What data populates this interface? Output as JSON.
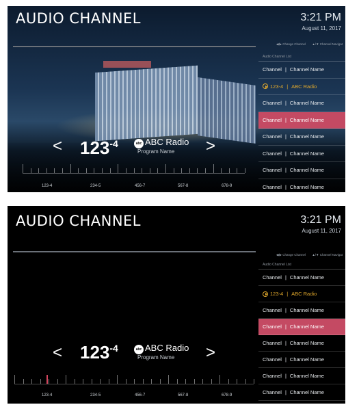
{
  "screens": [
    {
      "title": "AUDIO CHANNEL",
      "time": "3:21 PM",
      "date": "August 11, 2017",
      "hints": [
        "◀/▶ Change Channel",
        "▲/▼ Channel Navigat"
      ],
      "list_header": "Audio Channel List",
      "list": [
        {
          "left": "Channel",
          "sep": "|",
          "right": "Channel Name",
          "state": "normal"
        },
        {
          "left": "123-4",
          "sep": "|",
          "right": "ABC Radio",
          "state": "playing"
        },
        {
          "left": "Channel",
          "sep": "|",
          "right": "Channel Name",
          "state": "normal"
        },
        {
          "left": "Channel",
          "sep": "|",
          "right": "Channel Name",
          "state": "selected"
        },
        {
          "left": "Channel",
          "sep": "|",
          "right": "Channel Name",
          "state": "normal"
        },
        {
          "left": "Channel",
          "sep": "|",
          "right": "Channel Name",
          "state": "normal"
        },
        {
          "left": "Channel",
          "sep": "|",
          "right": "Channel Name",
          "state": "normal"
        },
        {
          "left": "Channel",
          "sep": "|",
          "right": "Channel Name",
          "state": "normal"
        }
      ],
      "prev_arrow": "<",
      "next_arrow": ">",
      "channel_major": "123",
      "channel_minor": "-4",
      "logo": "abc",
      "station": "ABC Radio",
      "program": "Program Name",
      "ruler_labels": [
        "123-4",
        "234-5",
        "456-7",
        "567-8",
        "678-9"
      ]
    },
    {
      "title": "AUDIO CHANNEL",
      "time": "3:21 PM",
      "date": "August 11, 2017",
      "hints": [
        "◀/▶ Change Channel",
        "▲/▼ Channel Navigat"
      ],
      "list_header": "Audio Channel List",
      "list": [
        {
          "left": "Channel",
          "sep": "|",
          "right": "Channel Name",
          "state": "normal"
        },
        {
          "left": "123-4",
          "sep": "|",
          "right": "ABC Radio",
          "state": "playing"
        },
        {
          "left": "Channel",
          "sep": "|",
          "right": "Channel Name",
          "state": "normal"
        },
        {
          "left": "Channel",
          "sep": "|",
          "right": "Channel Name",
          "state": "selected"
        },
        {
          "left": "Channel",
          "sep": "|",
          "right": "Channel Name",
          "state": "normal"
        },
        {
          "left": "Channel",
          "sep": "|",
          "right": "Channel Name",
          "state": "normal"
        },
        {
          "left": "Channel",
          "sep": "|",
          "right": "Channel Name",
          "state": "normal"
        },
        {
          "left": "Channel",
          "sep": "|",
          "right": "Channel Name",
          "state": "normal"
        }
      ],
      "prev_arrow": "<",
      "next_arrow": ">",
      "channel_major": "123",
      "channel_minor": "-4",
      "logo": "abc",
      "station": "ABC Radio",
      "program": "Program Name",
      "ruler_labels": [
        "123-4",
        "234-5",
        "456-7",
        "567-8",
        "678-9"
      ]
    }
  ],
  "colors": {
    "selected_row": "#c44a63",
    "playing_text": "#e2a92c",
    "ruler_marker": "#d2455d"
  }
}
